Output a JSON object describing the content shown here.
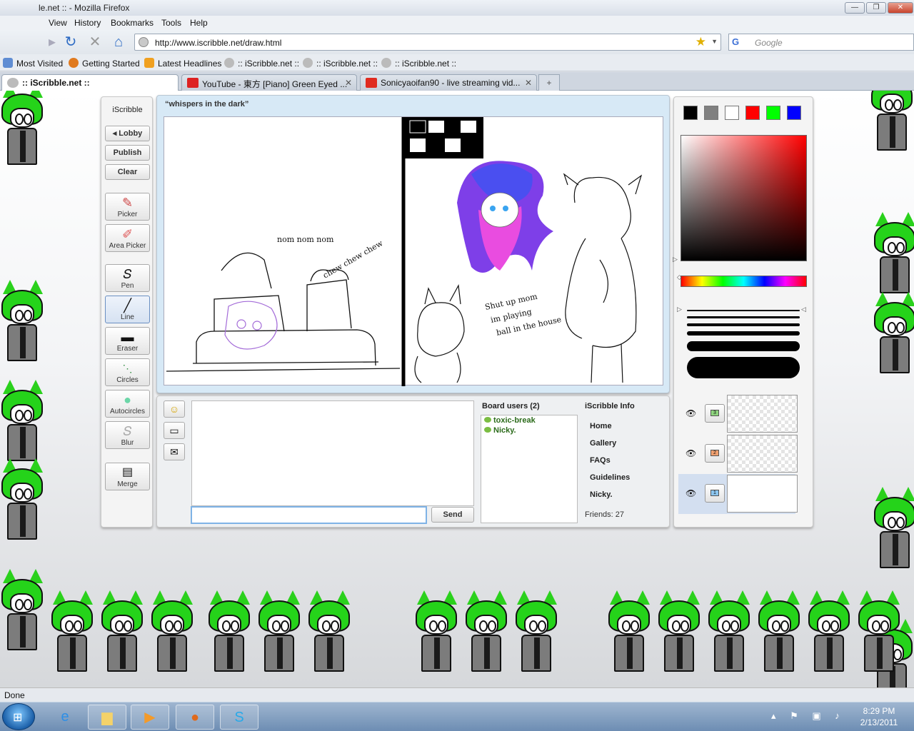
{
  "window": {
    "title": "le.net :: - Mozilla Firefox",
    "controls": [
      "—",
      "❐",
      "✕"
    ]
  },
  "menu": [
    "View",
    "History",
    "Bookmarks",
    "Tools",
    "Help"
  ],
  "nav": {
    "url": "http://www.iscribble.net/draw.html",
    "search_placeholder": "Google"
  },
  "bookmarks": [
    {
      "label": "Most Visited",
      "icon": "most-visited-icon"
    },
    {
      "label": "Getting Started",
      "icon": "firefox-icon"
    },
    {
      "label": "Latest Headlines",
      "icon": "rss-icon"
    },
    {
      "label": ":: iScribble.net ::",
      "icon": "iscribble-icon"
    },
    {
      "label": ":: iScribble.net ::",
      "icon": "iscribble-icon"
    },
    {
      "label": ":: iScribble.net ::",
      "icon": "iscribble-icon"
    }
  ],
  "tabs": [
    {
      "label": ":: iScribble.net ::",
      "active": true
    },
    {
      "label": "YouTube - 東方 [Piano] Green Eyed ...",
      "active": false
    },
    {
      "label": "Sonicyaoifan90 - live streaming vid...",
      "active": false
    }
  ],
  "tools": {
    "brand": "iScribble",
    "buttons": [
      "◂ Lobby",
      "Publish",
      "Clear"
    ],
    "items": [
      {
        "label": "Picker",
        "icon": "picker-icon"
      },
      {
        "label": "Area Picker",
        "icon": "area-picker-icon"
      },
      {
        "label": "Pen",
        "icon": "pen-icon"
      },
      {
        "label": "Line",
        "icon": "line-icon",
        "selected": true
      },
      {
        "label": "Eraser",
        "icon": "eraser-icon"
      },
      {
        "label": "Circles",
        "icon": "circles-icon"
      },
      {
        "label": "Autocircles",
        "icon": "autocircles-icon"
      },
      {
        "label": "Blur",
        "icon": "blur-icon"
      },
      {
        "label": "Merge",
        "icon": "merge-icon"
      }
    ]
  },
  "board": {
    "title": "“whispers in the dark”",
    "sketch_text": {
      "nom": "nom\nnom\nnom",
      "chew": "chew chew chew",
      "shut": "Shut\nup mom\nim playing\nball in the\nhouse"
    }
  },
  "chat": {
    "send_label": "Send",
    "input_value": "",
    "users_header": "Board users (2)",
    "users": [
      "toxic-break",
      "Nicky."
    ],
    "info_header": "iScribble Info",
    "info_links": [
      "Home",
      "Gallery",
      "FAQs",
      "Guidelines",
      "Nicky."
    ],
    "friends": "Friends: 27"
  },
  "palette": {
    "swatches": [
      "#000000",
      "#808080",
      "#ffffff",
      "#ff0000",
      "#00ff00",
      "#0000ff"
    ]
  },
  "layers": [
    {
      "number": "3",
      "color": "#8fd67f"
    },
    {
      "number": "2",
      "color": "#f0a070"
    },
    {
      "number": "1",
      "color": "#8cc6f0",
      "selected": true
    }
  ],
  "status": {
    "text": "Done"
  },
  "taskbar": {
    "time": "8:29 PM",
    "date": "2/13/2011"
  }
}
